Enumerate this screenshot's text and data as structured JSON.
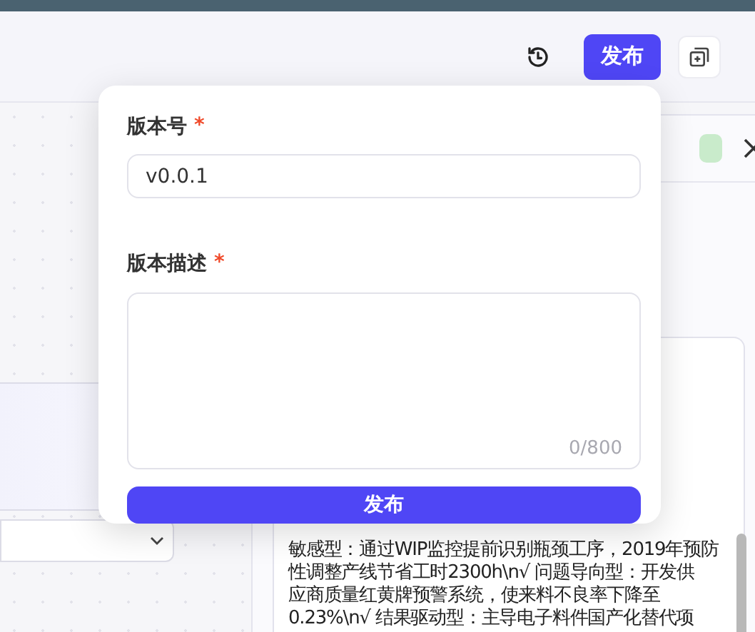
{
  "header": {
    "publish_button": "发布"
  },
  "popover": {
    "fields": [
      {
        "label": "版本号",
        "required_mark": "*",
        "kind": "input",
        "value": "v0.0.1"
      },
      {
        "label": "版本描述",
        "required_mark": "*",
        "kind": "textarea",
        "counter": "0/800"
      }
    ],
    "submit": "发布"
  },
  "detail_panel": {
    "text_lines": [
      "敏感型：通过WIP监控提前识别瓶颈工序，2019年预防",
      "性调整产线节省工时2300h\\n√ 问题导向型：开发供",
      "应商质量红黄牌预警系统，使来料不良率下降至",
      "0.23%\\n√ 结果驱动型：主导电子料件国产化替代项"
    ]
  }
}
